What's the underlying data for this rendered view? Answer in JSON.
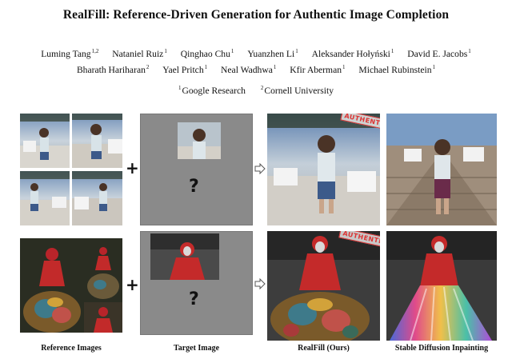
{
  "paper": {
    "title": "RealFill: Reference-Driven Generation for Authentic Image Completion",
    "authors": [
      {
        "name": "Luming Tang",
        "sup": "1,2"
      },
      {
        "name": "Nataniel Ruiz",
        "sup": "1"
      },
      {
        "name": "Qinghao Chu",
        "sup": "1"
      },
      {
        "name": "Yuanzhen Li",
        "sup": "1"
      },
      {
        "name": "Aleksander Hołyński",
        "sup": "1"
      },
      {
        "name": "David E. Jacobs",
        "sup": "1"
      },
      {
        "name": "Bharath Hariharan",
        "sup": "2"
      },
      {
        "name": "Yael Pritch",
        "sup": "1"
      },
      {
        "name": "Neal Wadhwa",
        "sup": "1"
      },
      {
        "name": "Kfir Aberman",
        "sup": "1"
      },
      {
        "name": "Michael Rubinstein",
        "sup": "1"
      }
    ],
    "affiliations": [
      {
        "sup": "1",
        "name": "Google Research"
      },
      {
        "sup": "2",
        "name": "Cornell University"
      }
    ]
  },
  "figure": {
    "plus": "+",
    "question_mark": "?",
    "stamp": "AUTHENTIC",
    "captions": [
      "Reference Images",
      "Target Image",
      "RealFill (Ours)",
      "Stable Diffusion Inpainting"
    ],
    "colors": {
      "target_gray": "#8a8a8a",
      "stamp_red": "#dd3333"
    }
  }
}
